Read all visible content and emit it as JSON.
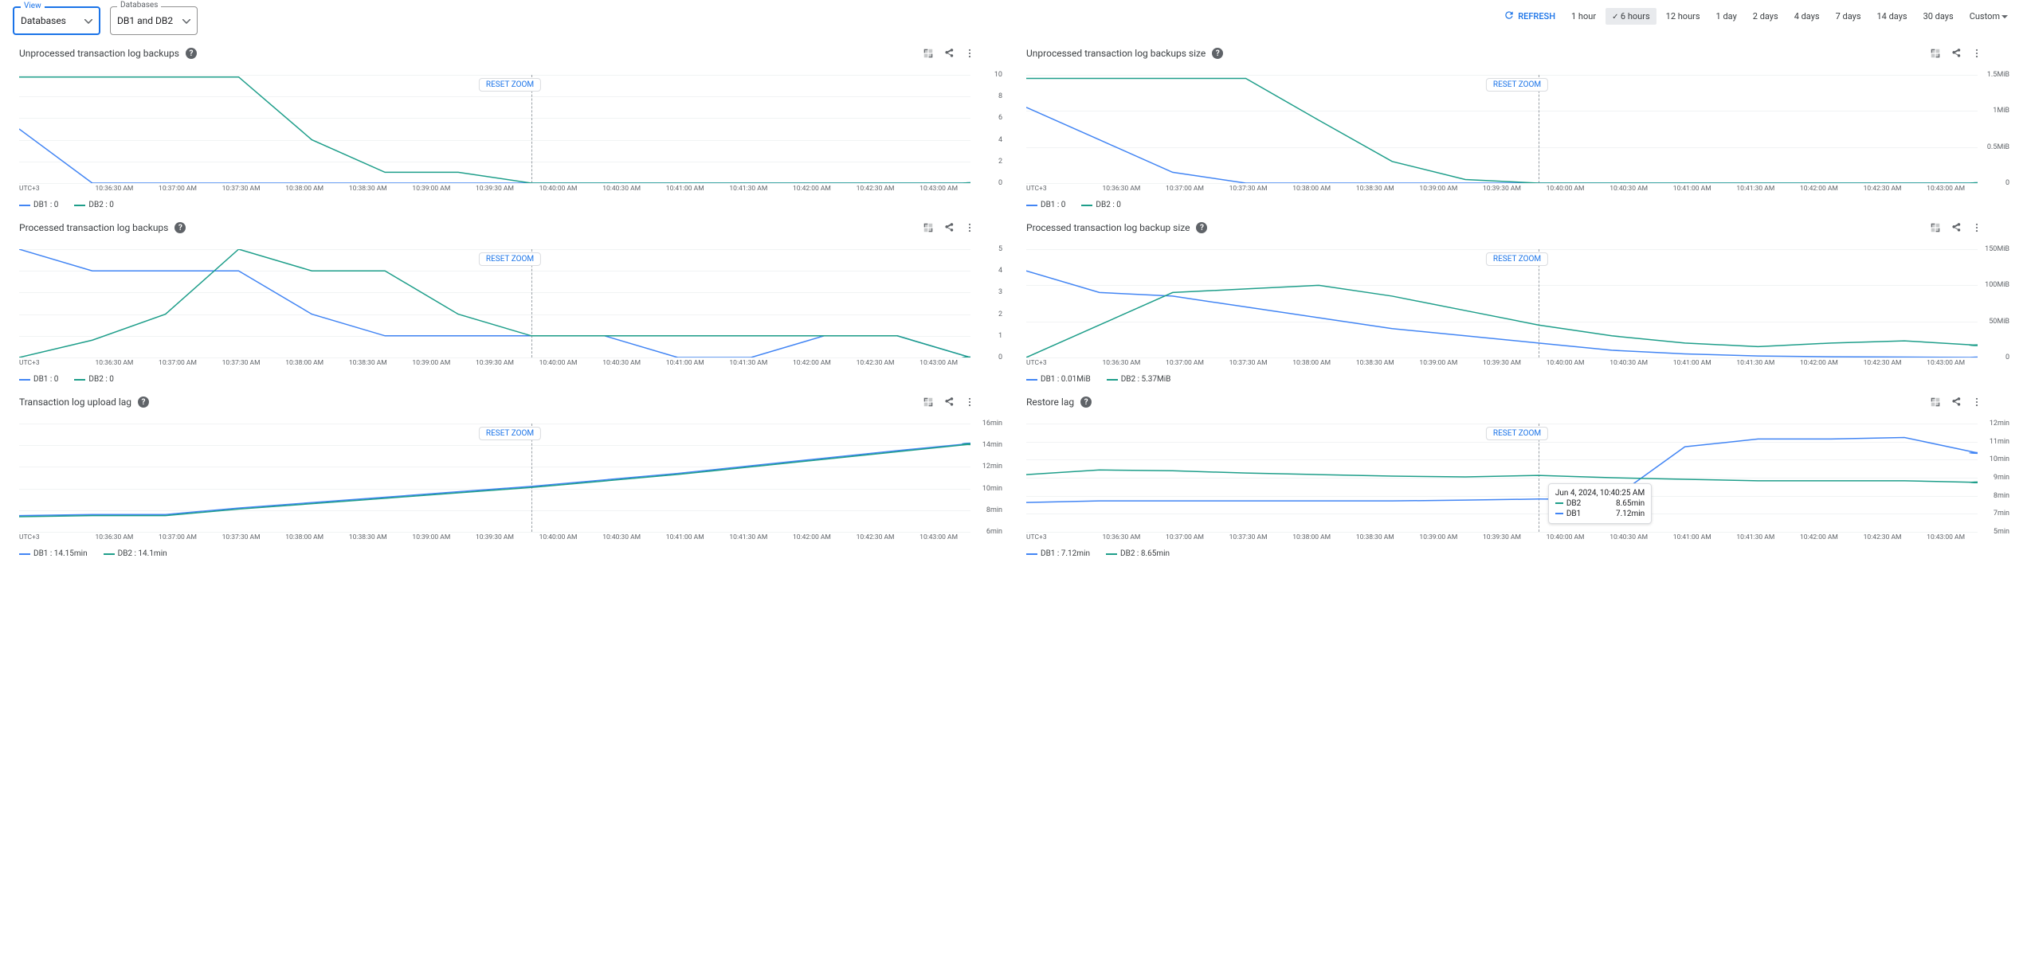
{
  "filters": {
    "view": {
      "label": "View",
      "value": "Databases"
    },
    "databases": {
      "label": "Databases",
      "value": "DB1 and DB2"
    }
  },
  "refresh_label": "REFRESH",
  "time_ranges": [
    "1 hour",
    "6 hours",
    "12 hours",
    "1 day",
    "2 days",
    "4 days",
    "7 days",
    "14 days",
    "30 days",
    "Custom"
  ],
  "time_selected": "6 hours",
  "reset_zoom_label": "RESET ZOOM",
  "x_first_label": "UTC+3",
  "x_labels": [
    "10:36:30 AM",
    "10:37:00 AM",
    "10:37:30 AM",
    "10:38:00 AM",
    "10:38:30 AM",
    "10:39:00 AM",
    "10:39:30 AM",
    "10:40:00 AM",
    "10:40:30 AM",
    "10:41:00 AM",
    "10:41:30 AM",
    "10:42:00 AM",
    "10:42:30 AM",
    "10:43:00 AM"
  ],
  "series_colors": {
    "DB1": "#4285f4",
    "DB2": "#1e9e8a"
  },
  "panels": [
    {
      "id": "unproc_count",
      "title": "Unprocessed transaction log backups",
      "y": {
        "ticks": [
          "0",
          "2",
          "4",
          "6",
          "8",
          "10"
        ],
        "max": 10
      },
      "legend": [
        {
          "name": "DB1",
          "value": "0"
        },
        {
          "name": "DB2",
          "value": "0"
        }
      ],
      "vline_at_index": 7
    },
    {
      "id": "unproc_size",
      "title": "Unprocessed transaction log backups size",
      "y": {
        "ticks": [
          "0",
          "0.5MiB",
          "1MiB",
          "1.5MiB"
        ],
        "max": 1.5
      },
      "legend": [
        {
          "name": "DB1",
          "value": "0"
        },
        {
          "name": "DB2",
          "value": "0"
        }
      ],
      "vline_at_index": 7
    },
    {
      "id": "proc_count",
      "title": "Processed transaction log backups",
      "y": {
        "ticks": [
          "0",
          "1",
          "2",
          "3",
          "4",
          "5"
        ],
        "max": 5
      },
      "legend": [
        {
          "name": "DB1",
          "value": "0"
        },
        {
          "name": "DB2",
          "value": "0"
        }
      ],
      "vline_at_index": 7
    },
    {
      "id": "proc_size",
      "title": "Processed transaction log backup size",
      "y": {
        "ticks": [
          "0",
          "50MiB",
          "100MiB",
          "150MiB"
        ],
        "max": 150
      },
      "legend": [
        {
          "name": "DB1",
          "value": "0.01MiB"
        },
        {
          "name": "DB2",
          "value": "5.37MiB"
        }
      ],
      "vline_at_index": 7
    },
    {
      "id": "upload_lag",
      "title": "Transaction log upload lag",
      "y": {
        "ticks": [
          "6min",
          "8min",
          "10min",
          "12min",
          "14min",
          "16min"
        ],
        "min": 6,
        "max": 16
      },
      "legend": [
        {
          "name": "DB1",
          "value": "14.15min"
        },
        {
          "name": "DB2",
          "value": "14.1min"
        }
      ],
      "vline_at_index": 7
    },
    {
      "id": "restore_lag",
      "title": "Restore lag",
      "y": {
        "ticks": [
          "5min",
          "7min",
          "8min",
          "9min",
          "10min",
          "11min",
          "12min"
        ],
        "min": 5,
        "max": 12
      },
      "legend": [
        {
          "name": "DB1",
          "value": "7.12min"
        },
        {
          "name": "DB2",
          "value": "8.65min"
        }
      ],
      "vline_at_index": 7,
      "tooltip": {
        "time": "Jun 4, 2024, 10:40:25 AM",
        "rows": [
          {
            "name": "DB2",
            "value": "8.65min"
          },
          {
            "name": "DB1",
            "value": "7.12min"
          }
        ]
      }
    }
  ],
  "chart_data": [
    {
      "id": "unproc_count",
      "type": "line",
      "title": "Unprocessed transaction log backups",
      "xlabel": "UTC+3",
      "ylabel": "",
      "ylim": [
        0,
        10
      ],
      "x": [
        "10:36:30",
        "10:37:00",
        "10:37:30",
        "10:38:00",
        "10:38:30",
        "10:39:00",
        "10:39:30",
        "10:40:00",
        "10:40:30",
        "10:41:00",
        "10:41:30",
        "10:42:00",
        "10:42:30",
        "10:43:00"
      ],
      "series": [
        {
          "name": "DB1",
          "values": [
            5,
            0,
            0,
            0,
            0,
            0,
            0,
            0,
            0,
            0,
            0,
            0,
            0,
            0
          ]
        },
        {
          "name": "DB2",
          "values": [
            9.8,
            9.8,
            9.8,
            9.8,
            4,
            1,
            1,
            0,
            0,
            0,
            0,
            0,
            0,
            0
          ]
        }
      ]
    },
    {
      "id": "unproc_size",
      "type": "line",
      "title": "Unprocessed transaction log backups size",
      "xlabel": "UTC+3",
      "ylabel": "MiB",
      "ylim": [
        0,
        1.5
      ],
      "x": [
        "10:36:30",
        "10:37:00",
        "10:37:30",
        "10:38:00",
        "10:38:30",
        "10:39:00",
        "10:39:30",
        "10:40:00",
        "10:40:30",
        "10:41:00",
        "10:41:30",
        "10:42:00",
        "10:42:30",
        "10:43:00"
      ],
      "series": [
        {
          "name": "DB1",
          "values": [
            1.05,
            0.6,
            0.15,
            0,
            0,
            0,
            0,
            0,
            0,
            0,
            0,
            0,
            0,
            0
          ]
        },
        {
          "name": "DB2",
          "values": [
            1.45,
            1.45,
            1.45,
            1.45,
            0.87,
            0.3,
            0.05,
            0,
            0,
            0,
            0,
            0,
            0,
            0
          ]
        }
      ]
    },
    {
      "id": "proc_count",
      "type": "line",
      "title": "Processed transaction log backups",
      "xlabel": "UTC+3",
      "ylabel": "",
      "ylim": [
        0,
        5
      ],
      "x": [
        "10:36:30",
        "10:37:00",
        "10:37:30",
        "10:38:00",
        "10:38:30",
        "10:39:00",
        "10:39:30",
        "10:40:00",
        "10:40:30",
        "10:41:00",
        "10:41:30",
        "10:42:00",
        "10:42:30",
        "10:43:00"
      ],
      "series": [
        {
          "name": "DB1",
          "values": [
            5,
            4,
            4,
            4,
            2,
            1,
            1,
            1,
            1,
            0,
            0,
            1,
            1,
            0
          ]
        },
        {
          "name": "DB2",
          "values": [
            0,
            0.8,
            2,
            5,
            4,
            4,
            2,
            1,
            1,
            1,
            1,
            1,
            1,
            0
          ]
        }
      ]
    },
    {
      "id": "proc_size",
      "type": "line",
      "title": "Processed transaction log backup size",
      "xlabel": "UTC+3",
      "ylabel": "MiB",
      "ylim": [
        0,
        150
      ],
      "x": [
        "10:36:30",
        "10:37:00",
        "10:37:30",
        "10:38:00",
        "10:38:30",
        "10:39:00",
        "10:39:30",
        "10:40:00",
        "10:40:30",
        "10:41:00",
        "10:41:30",
        "10:42:00",
        "10:42:30",
        "10:43:00"
      ],
      "series": [
        {
          "name": "DB1",
          "values": [
            120,
            90,
            85,
            70,
            55,
            40,
            30,
            20,
            10,
            5,
            2,
            1,
            0.5,
            0.01
          ]
        },
        {
          "name": "DB2",
          "values": [
            0,
            45,
            90,
            95,
            100,
            85,
            65,
            45,
            30,
            20,
            15,
            20,
            23,
            17
          ]
        }
      ]
    },
    {
      "id": "upload_lag",
      "type": "line",
      "title": "Transaction log upload lag",
      "xlabel": "UTC+3",
      "ylabel": "min",
      "ylim": [
        6,
        16
      ],
      "x": [
        "10:36:30",
        "10:37:00",
        "10:37:30",
        "10:38:00",
        "10:38:30",
        "10:39:00",
        "10:39:30",
        "10:40:00",
        "10:40:30",
        "10:41:00",
        "10:41:30",
        "10:42:00",
        "10:42:30",
        "10:43:00"
      ],
      "series": [
        {
          "name": "DB1",
          "values": [
            7.5,
            7.6,
            7.6,
            8.2,
            8.7,
            9.2,
            9.7,
            10.2,
            10.8,
            11.4,
            12.1,
            12.8,
            13.5,
            14.15
          ]
        },
        {
          "name": "DB2",
          "values": [
            7.4,
            7.5,
            7.5,
            8.1,
            8.6,
            9.1,
            9.6,
            10.1,
            10.7,
            11.3,
            12.0,
            12.7,
            13.4,
            14.1
          ]
        }
      ]
    },
    {
      "id": "restore_lag",
      "type": "line",
      "title": "Restore lag",
      "xlabel": "UTC+3",
      "ylabel": "min",
      "ylim": [
        5,
        12
      ],
      "x": [
        "10:36:30",
        "10:37:00",
        "10:37:30",
        "10:38:00",
        "10:38:30",
        "10:39:00",
        "10:39:30",
        "10:40:00",
        "10:40:30",
        "10:41:00",
        "10:41:30",
        "10:42:00",
        "10:42:30",
        "10:43:00"
      ],
      "series": [
        {
          "name": "DB1",
          "values": [
            6.9,
            7.0,
            7.0,
            7.0,
            7.0,
            7.0,
            7.05,
            7.12,
            7.1,
            10.5,
            11.0,
            11.0,
            11.1,
            10.1
          ]
        },
        {
          "name": "DB2",
          "values": [
            8.7,
            9.0,
            8.95,
            8.8,
            8.7,
            8.6,
            8.55,
            8.65,
            8.5,
            8.4,
            8.3,
            8.3,
            8.3,
            8.2
          ]
        }
      ]
    }
  ]
}
